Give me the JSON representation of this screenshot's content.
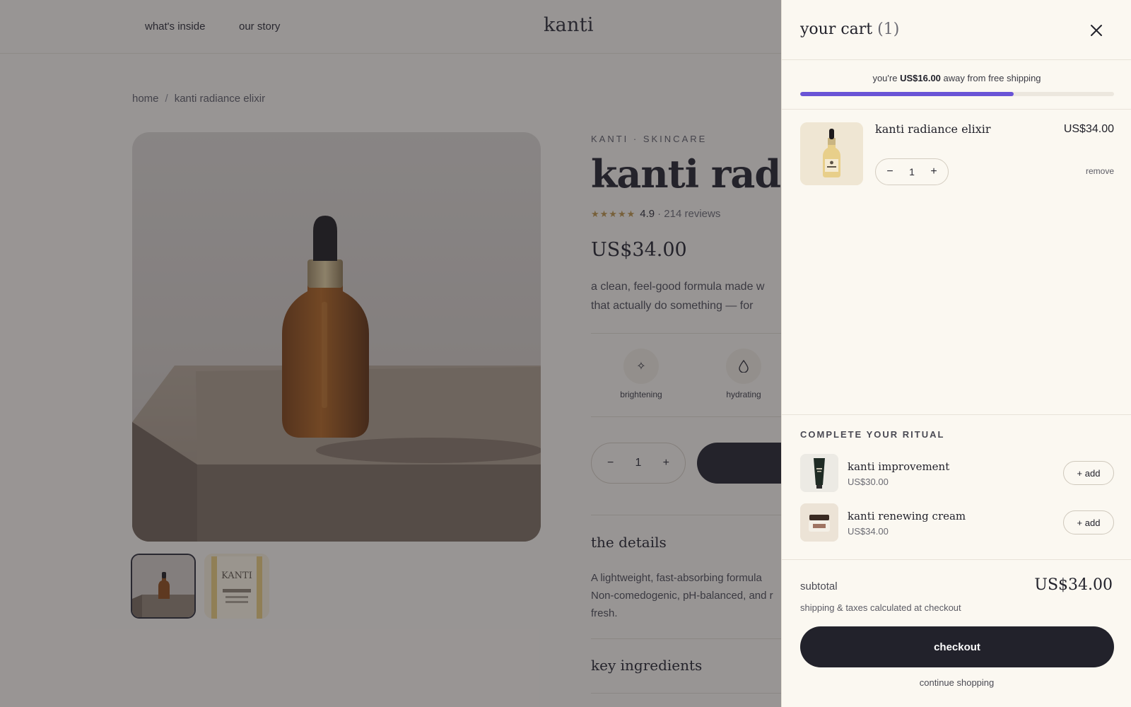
{
  "site": {
    "logo": "kanti",
    "nav": [
      {
        "label": "what's inside"
      },
      {
        "label": "our story"
      }
    ]
  },
  "breadcrumb": {
    "home": "home",
    "separator": "/",
    "current": "kanti radiance elixir"
  },
  "product": {
    "brand_line": "KANTI · SKINCARE",
    "title": "kanti radiance elixir",
    "stars": "★★★★★",
    "rating": "4.9",
    "reviews": "· 214 reviews",
    "price": "US$34.00",
    "description_line1": "a clean, feel-good formula made w",
    "description_line2": "that actually do something — for",
    "benefits": [
      {
        "label": "brightening",
        "icon": "sparkle-icon"
      },
      {
        "label": "hydrating",
        "icon": "droplet-icon"
      }
    ],
    "quantity": {
      "minus": "−",
      "value": "1",
      "plus": "+"
    },
    "thumb2_label": "KANTI",
    "details_title": "the details",
    "details_line1": "A lightweight, fast-absorbing formula",
    "details_line2": "Non-comedogenic, pH-balanced, and r",
    "details_line3": "fresh.",
    "ingredients_title": "key ingredients"
  },
  "cart": {
    "title": "your cart",
    "count": "(1)",
    "close_icon": "close-icon",
    "shipping": {
      "prefix": "you're ",
      "amount": "US$16.00",
      "suffix": " away from free shipping",
      "progress_fraction": 0.68
    },
    "items": [
      {
        "name": "kanti radiance elixir",
        "price": "US$34.00",
        "qty": "1",
        "minus": "−",
        "plus": "+",
        "remove": "remove"
      }
    ],
    "ritual": {
      "title": "COMPLETE YOUR RITUAL",
      "items": [
        {
          "name": "kanti improvement",
          "price": "US$30.00",
          "add": "+ add"
        },
        {
          "name": "kanti renewing cream",
          "price": "US$34.00",
          "add": "+ add"
        }
      ]
    },
    "subtotal_label": "subtotal",
    "subtotal_value": "US$34.00",
    "tax_note": "shipping & taxes calculated at checkout",
    "checkout_label": "checkout",
    "continue_label": "continue shopping"
  },
  "colors": {
    "accent": "#6a54d6",
    "dark": "#22222b",
    "panel": "#fbf8f1",
    "gold": "#b89045"
  }
}
